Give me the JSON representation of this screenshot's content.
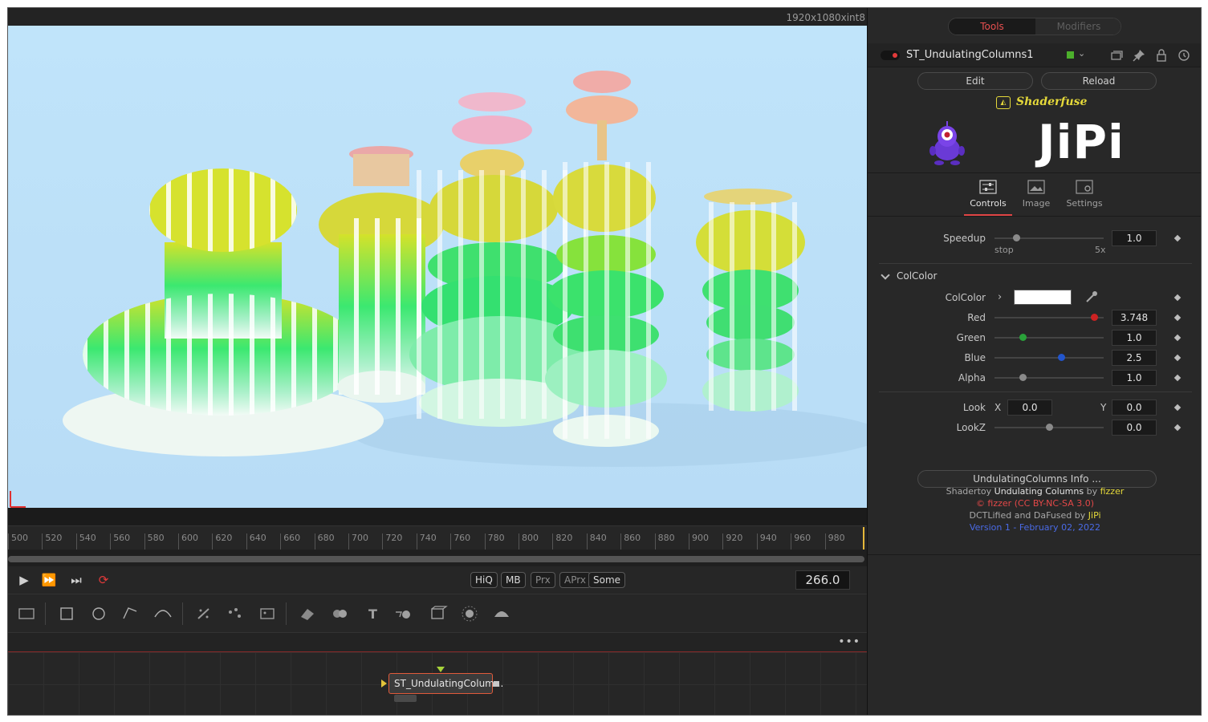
{
  "viewer": {
    "resolution": "1920x1080xint8"
  },
  "ruler": {
    "ticks": [
      "500",
      "520",
      "540",
      "560",
      "580",
      "600",
      "620",
      "640",
      "660",
      "680",
      "700",
      "720",
      "740",
      "760",
      "780",
      "800",
      "820",
      "840",
      "860",
      "880",
      "900",
      "920",
      "940",
      "960",
      "980"
    ]
  },
  "transport": {
    "pills": [
      "HiQ",
      "MB",
      "Prx",
      "APrx",
      "Some"
    ],
    "current_frame": "266.0"
  },
  "toolbar": {
    "icons": [
      "background-icon",
      "rectangle-icon",
      "ellipse-icon",
      "polygon-icon",
      "bspline-icon",
      "paint-icon",
      "particle-emitter-icon",
      "particle-render-icon",
      "shape3d-icon",
      "merge3d-icon",
      "text3d-icon",
      "renderer3d-icon",
      "camera3d-icon",
      "light3d-icon",
      "fog3d-icon"
    ]
  },
  "flow": {
    "more": "•••",
    "node_label": "ST_UndulatingColum..."
  },
  "inspector": {
    "tabs": {
      "tools": "Tools",
      "modifiers": "Modifiers"
    },
    "tool_name": "ST_UndulatingColumns1",
    "tool_color": "#4caf2c",
    "edit": "Edit",
    "reload": "Reload",
    "shaderfuse": "Shaderfuse",
    "brand": "JiPi",
    "panel_tabs": {
      "controls": "Controls",
      "image": "Image",
      "settings": "Settings"
    },
    "speedup": {
      "label": "Speedup",
      "value": "1.0",
      "min_label": "stop",
      "max_label": "5x",
      "fraction": 0.2
    },
    "section": "ColColor",
    "colcolor_label": "ColColor",
    "red": {
      "label": "Red",
      "value": "3.748",
      "fraction": 0.91,
      "knob_color": "#cc2222"
    },
    "green": {
      "label": "Green",
      "value": "1.0",
      "fraction": 0.26,
      "knob_color": "#2aa23a"
    },
    "blue": {
      "label": "Blue",
      "value": "2.5",
      "fraction": 0.61,
      "knob_color": "#2255cc"
    },
    "alpha": {
      "label": "Alpha",
      "value": "1.0",
      "fraction": 0.26,
      "knob_color": "#8a8a8a"
    },
    "look": {
      "label": "Look",
      "x_label": "X",
      "x_value": "0.0",
      "y_label": "Y",
      "y_value": "0.0"
    },
    "lookz": {
      "label": "LookZ",
      "value": "0.0",
      "fraction": 0.5,
      "knob_color": "#8a8a8a"
    },
    "info_button": "UndulatingColumns Info ...",
    "info": {
      "l1a": "Shadertoy",
      "l1b": "Undulating Columns",
      "l1c": "by",
      "l1d": "fizzer",
      "l2": "© fizzer (CC BY-NC-SA 3.0)",
      "l3a": "DCTLified and DaFused by",
      "l3b": "JiPi",
      "l4": "Version 1 - February 02, 2022"
    }
  }
}
